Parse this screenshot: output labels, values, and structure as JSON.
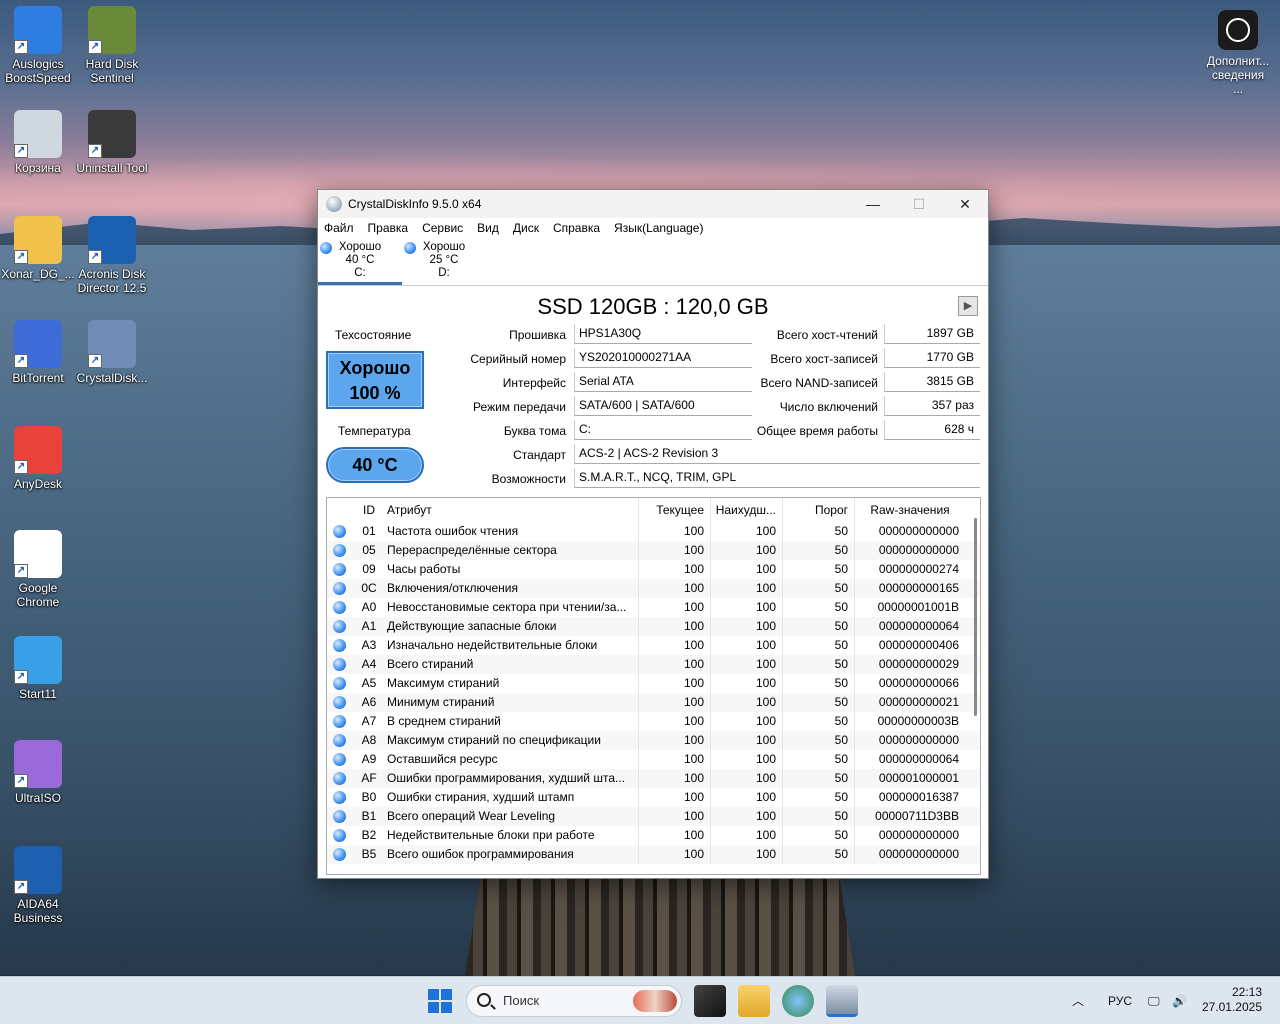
{
  "desktop": {
    "icons": [
      {
        "label": "Auslogics BoostSpeed",
        "icon": "auslogics-icon"
      },
      {
        "label": "Hard Disk Sentinel",
        "icon": "harddisk-sentinel-icon"
      },
      {
        "label": "Корзина",
        "icon": "recycle-bin-icon"
      },
      {
        "label": "Uninstall Tool",
        "icon": "uninstall-tool-icon"
      },
      {
        "label": "Xonar_DG_...",
        "icon": "folder-icon"
      },
      {
        "label": "Acronis Disk Director 12.5",
        "icon": "acronis-icon"
      },
      {
        "label": "BitTorrent",
        "icon": "bittorrent-icon"
      },
      {
        "label": "CrystalDisk...",
        "icon": "crystaldisk-icon"
      },
      {
        "label": "AnyDesk",
        "icon": "anydesk-icon"
      },
      {
        "label": "Google Chrome",
        "icon": "chrome-icon"
      },
      {
        "label": "Start11",
        "icon": "start11-icon"
      },
      {
        "label": "UltraISO",
        "icon": "ultraiso-icon"
      },
      {
        "label": "AIDA64 Business",
        "icon": "aida64-icon"
      }
    ],
    "top_right": {
      "label": "Дополнит... сведения ..."
    }
  },
  "window": {
    "title": "CrystalDiskInfo 9.5.0 x64",
    "menu": [
      "Файл",
      "Правка",
      "Сервис",
      "Вид",
      "Диск",
      "Справка",
      "Язык(Language)"
    ],
    "drives": [
      {
        "status": "Хорошо",
        "temp": "40 °C",
        "letter": "C:"
      },
      {
        "status": "Хорошо",
        "temp": "25 °C",
        "letter": "D:"
      }
    ],
    "disk_title": "SSD 120GB : 120,0 GB",
    "health_label": "Техсостояние",
    "health_status": "Хорошо",
    "health_percent": "100 %",
    "temp_label": "Температура",
    "temp_value": "40 °C",
    "info": {
      "firmware_label": "Прошивка",
      "firmware": "HPS1A30Q",
      "serial_label": "Серийный номер",
      "serial": "YS202010000271AA",
      "interface_label": "Интерфейс",
      "interface": "Serial ATA",
      "mode_label": "Режим передачи",
      "mode": "SATA/600 | SATA/600",
      "volume_label": "Буква тома",
      "volume": "C:",
      "standard_label": "Стандарт",
      "standard": "ACS-2 | ACS-2 Revision 3",
      "features_label": "Возможности",
      "features": "S.M.A.R.T., NCQ, TRIM, GPL",
      "host_reads_label": "Всего хост-чтений",
      "host_reads": "1897 GB",
      "host_writes_label": "Всего хост-записей",
      "host_writes": "1770 GB",
      "nand_writes_label": "Всего NAND-записей",
      "nand_writes": "3815 GB",
      "power_count_label": "Число включений",
      "power_count": "357 раз",
      "power_hours_label": "Общее время работы",
      "power_hours": "628 ч"
    },
    "smart_headers": {
      "id": "ID",
      "attr": "Атрибут",
      "cur": "Текущее",
      "worst": "Наихудш...",
      "thr": "Порог",
      "raw": "Raw-значения"
    },
    "smart_rows": [
      {
        "id": "01",
        "attr": "Частота ошибок чтения",
        "cur": "100",
        "worst": "100",
        "thr": "50",
        "raw": "000000000000"
      },
      {
        "id": "05",
        "attr": "Перераспределённые сектора",
        "cur": "100",
        "worst": "100",
        "thr": "50",
        "raw": "000000000000"
      },
      {
        "id": "09",
        "attr": "Часы работы",
        "cur": "100",
        "worst": "100",
        "thr": "50",
        "raw": "000000000274"
      },
      {
        "id": "0C",
        "attr": "Включения/отключения",
        "cur": "100",
        "worst": "100",
        "thr": "50",
        "raw": "000000000165"
      },
      {
        "id": "A0",
        "attr": "Невосстановимые сектора при чтении/за...",
        "cur": "100",
        "worst": "100",
        "thr": "50",
        "raw": "00000001001B"
      },
      {
        "id": "A1",
        "attr": "Действующие запасные блоки",
        "cur": "100",
        "worst": "100",
        "thr": "50",
        "raw": "000000000064"
      },
      {
        "id": "A3",
        "attr": "Изначально недействительные блоки",
        "cur": "100",
        "worst": "100",
        "thr": "50",
        "raw": "000000000406"
      },
      {
        "id": "A4",
        "attr": "Всего стираний",
        "cur": "100",
        "worst": "100",
        "thr": "50",
        "raw": "000000000029"
      },
      {
        "id": "A5",
        "attr": "Максимум стираний",
        "cur": "100",
        "worst": "100",
        "thr": "50",
        "raw": "000000000066"
      },
      {
        "id": "A6",
        "attr": "Минимум стираний",
        "cur": "100",
        "worst": "100",
        "thr": "50",
        "raw": "000000000021"
      },
      {
        "id": "A7",
        "attr": "В среднем стираний",
        "cur": "100",
        "worst": "100",
        "thr": "50",
        "raw": "00000000003B"
      },
      {
        "id": "A8",
        "attr": "Максимум стираний по спецификации",
        "cur": "100",
        "worst": "100",
        "thr": "50",
        "raw": "000000000000"
      },
      {
        "id": "A9",
        "attr": "Оставшийся ресурс",
        "cur": "100",
        "worst": "100",
        "thr": "50",
        "raw": "000000000064"
      },
      {
        "id": "AF",
        "attr": "Ошибки программирования, худший шта...",
        "cur": "100",
        "worst": "100",
        "thr": "50",
        "raw": "000001000001"
      },
      {
        "id": "B0",
        "attr": "Ошибки стирания, худший штамп",
        "cur": "100",
        "worst": "100",
        "thr": "50",
        "raw": "000000016387"
      },
      {
        "id": "B1",
        "attr": "Всего операций Wear Leveling",
        "cur": "100",
        "worst": "100",
        "thr": "50",
        "raw": "00000711D3BB"
      },
      {
        "id": "B2",
        "attr": "Недействительные блоки при работе",
        "cur": "100",
        "worst": "100",
        "thr": "50",
        "raw": "000000000000"
      },
      {
        "id": "B5",
        "attr": "Всего ошибок программирования",
        "cur": "100",
        "worst": "100",
        "thr": "50",
        "raw": "000000000000"
      }
    ]
  },
  "taskbar": {
    "search_placeholder": "Поиск",
    "lang": "РУС",
    "time": "22:13",
    "date": "27.01.2025"
  },
  "colors": {
    "accent": "#1e73d8",
    "health": "#5ba6ec"
  }
}
